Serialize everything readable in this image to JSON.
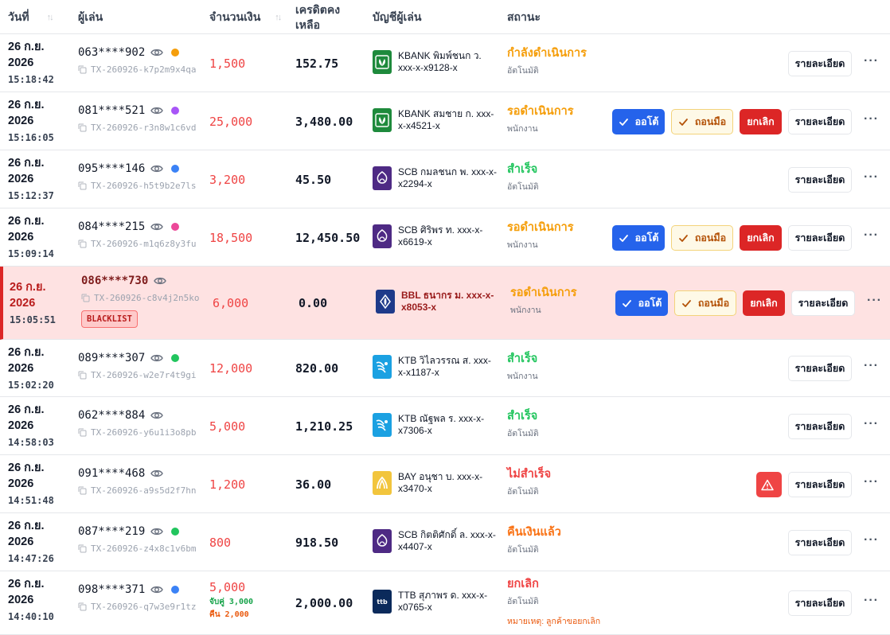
{
  "headers": {
    "date": "วันที่",
    "player": "ผู้เล่น",
    "amount": "จำนวนเงิน",
    "credit_line1": "เครดิตคง",
    "credit_line2": "เหลือ",
    "account": "บัญชีผู้เล่น",
    "status": "สถานะ"
  },
  "labels": {
    "auto": "ออโต้",
    "manual": "ถอนมือ",
    "cancel": "ยกเลิก",
    "detail": "รายละเอียด",
    "blacklist": "BLACKLIST",
    "more": "···"
  },
  "colors": {
    "kbank": "#1e8a3c",
    "scb": "#4e2a84",
    "bbl": "#1e3a8a",
    "ktb": "#1ba1e2",
    "bay": "#f2c53d",
    "ttb": "#0b2a5b",
    "primary": "#2563eb",
    "danger": "#dc2626"
  },
  "rows": [
    {
      "date": "26 ก.ย. 2026",
      "time": "15:18:42",
      "phone": "063****902",
      "dot": "#f59e0b",
      "tx": "TX-260926-k7p2m9x4qa",
      "amount": "1,500",
      "credit": "152.75",
      "bank": "kbank",
      "account": "KBANK พิมพ์ชนก ว. xxx-x-x9128-x",
      "status": "กำลังดำเนินการ",
      "status_color": "orange",
      "by": "อัตโนมัติ",
      "actions": false
    },
    {
      "date": "26 ก.ย. 2026",
      "time": "15:16:05",
      "phone": "081****521",
      "dot": "#a855f7",
      "tx": "TX-260926-r3n8w1c6vd",
      "amount": "25,000",
      "credit": "3,480.00",
      "bank": "kbank",
      "account": "KBANK สมชาย ก. xxx-x-x4521-x",
      "status": "รอดำเนินการ",
      "status_color": "orange",
      "by": "พนักงาน",
      "actions": true
    },
    {
      "date": "26 ก.ย. 2026",
      "time": "15:12:37",
      "phone": "095****146",
      "dot": "#3b82f6",
      "tx": "TX-260926-h5t9b2e7ls",
      "amount": "3,200",
      "credit": "45.50",
      "bank": "scb",
      "account": "SCB กมลชนก พ. xxx-x-x2294-x",
      "status": "สำเร็จ",
      "status_color": "green",
      "by": "อัตโนมัติ",
      "actions": false
    },
    {
      "date": "26 ก.ย. 2026",
      "time": "15:09:14",
      "phone": "084****215",
      "dot": "#ec4899",
      "tx": "TX-260926-m1q6z8y3fu",
      "amount": "18,500",
      "credit": "12,450.50",
      "bank": "scb",
      "account": "SCB ศิริพร ท. xxx-x-x6619-x",
      "status": "รอดำเนินการ",
      "status_color": "orange",
      "by": "พนักงาน",
      "actions": true
    },
    {
      "date": "26 ก.ย. 2026",
      "time": "15:05:51",
      "phone": "086****730",
      "dot": "",
      "tx": "TX-260926-c8v4j2n5ko",
      "amount": "6,000",
      "credit": "0.00",
      "bank": "bbl",
      "account": "BBL ธนากร ม. xxx-x-x8053-x",
      "status": "รอดำเนินการ",
      "status_color": "orange",
      "by": "พนักงาน",
      "actions": true,
      "blacklist": true
    },
    {
      "date": "26 ก.ย. 2026",
      "time": "15:02:20",
      "phone": "089****307",
      "dot": "#22c55e",
      "tx": "TX-260926-w2e7r4t9gi",
      "amount": "12,000",
      "credit": "820.00",
      "bank": "ktb",
      "account": "KTB วิไลวรรณ ส. xxx-x-x1187-x",
      "status": "สำเร็จ",
      "status_color": "green",
      "by": "พนักงาน",
      "actions": false
    },
    {
      "date": "26 ก.ย. 2026",
      "time": "14:58:03",
      "phone": "062****884",
      "dot": "",
      "tx": "TX-260926-y6u1i3o8pb",
      "amount": "5,000",
      "credit": "1,210.25",
      "bank": "ktb",
      "account": "KTB ณัฐพล ร. xxx-x-x7306-x",
      "status": "สำเร็จ",
      "status_color": "green",
      "by": "อัตโนมัติ",
      "actions": false
    },
    {
      "date": "26 ก.ย. 2026",
      "time": "14:51:48",
      "phone": "091****468",
      "dot": "",
      "tx": "TX-260926-a9s5d2f7hn",
      "amount": "1,200",
      "credit": "36.00",
      "bank": "bay",
      "account": "BAY อนุชา บ. xxx-x-x3470-x",
      "status": "ไม่สำเร็จ",
      "status_color": "red",
      "by": "อัตโนมัติ",
      "actions": false,
      "warn": true
    },
    {
      "date": "26 ก.ย. 2026",
      "time": "14:47:26",
      "phone": "087****219",
      "dot": "#22c55e",
      "tx": "TX-260926-z4x8c1v6bm",
      "amount": "800",
      "credit": "918.50",
      "bank": "scb",
      "account": "SCB กิตติศักดิ์ ล. xxx-x-x4407-x",
      "status": "คืนเงินแล้ว",
      "status_color": "orange2",
      "by": "อัตโนมัติ",
      "actions": false
    },
    {
      "date": "26 ก.ย. 2026",
      "time": "14:40:10",
      "phone": "098****371",
      "dot": "#3b82f6",
      "tx": "TX-260926-q7w3e9r1tz",
      "amount": "5,000",
      "paid": "จับคู่ 3,000",
      "refund": "คืน 2,000",
      "credit": "2,000.00",
      "bank": "ttb",
      "account": "TTB สุภาพร ด. xxx-x-x0765-x",
      "status": "ยกเลิก",
      "status_color": "red",
      "by": "อัตโนมัติ",
      "note": "หมายเหตุ: ลูกค้าขอยกเลิก",
      "actions": false
    }
  ]
}
